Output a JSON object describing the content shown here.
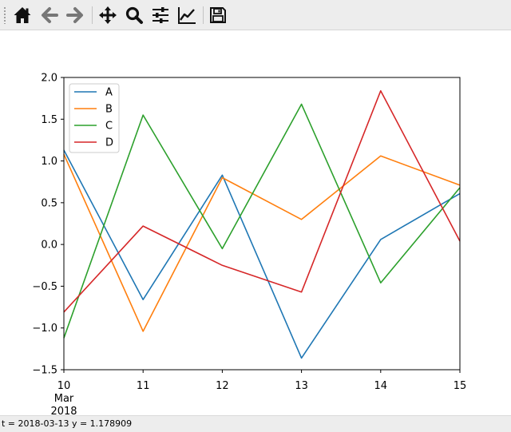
{
  "toolbar": {
    "buttons": [
      {
        "name": "home-icon"
      },
      {
        "name": "back-arrow-icon"
      },
      {
        "name": "forward-arrow-icon"
      },
      {
        "name": "pan-move-icon"
      },
      {
        "name": "zoom-magnifier-icon"
      },
      {
        "name": "configure-subplots-icon"
      },
      {
        "name": "edit-axes-icon"
      },
      {
        "name": "save-figure-icon"
      }
    ]
  },
  "status": {
    "text": "t = 2018-03-13  y = 1.178909"
  },
  "chart_data": {
    "type": "line",
    "x": [
      "2018-03-10",
      "2018-03-11",
      "2018-03-12",
      "2018-03-13",
      "2018-03-14",
      "2018-03-15"
    ],
    "xticks": [
      "10",
      "11",
      "12",
      "13",
      "14",
      "15"
    ],
    "x_sublabel": [
      "Mar",
      "2018"
    ],
    "ylim": [
      -1.5,
      2.0
    ],
    "yticks": [
      "2.0",
      "1.5",
      "1.0",
      "0.5",
      "0.0",
      "−0.5",
      "−1.0",
      "−1.5"
    ],
    "ytick_values": [
      2.0,
      1.5,
      1.0,
      0.5,
      0.0,
      -0.5,
      -1.0,
      -1.5
    ],
    "grid": false,
    "legend_position": "top-left",
    "series": [
      {
        "name": "A",
        "color": "#1f77b4",
        "values": [
          1.13,
          -0.66,
          0.83,
          -1.36,
          0.06,
          0.61
        ]
      },
      {
        "name": "B",
        "color": "#ff7f0e",
        "values": [
          1.08,
          -1.04,
          0.8,
          0.3,
          1.06,
          0.71
        ]
      },
      {
        "name": "C",
        "color": "#2ca02c",
        "values": [
          -1.12,
          1.55,
          -0.05,
          1.68,
          -0.46,
          0.68
        ]
      },
      {
        "name": "D",
        "color": "#d62728",
        "values": [
          -0.81,
          0.22,
          -0.25,
          -0.57,
          1.84,
          0.04
        ]
      }
    ]
  }
}
